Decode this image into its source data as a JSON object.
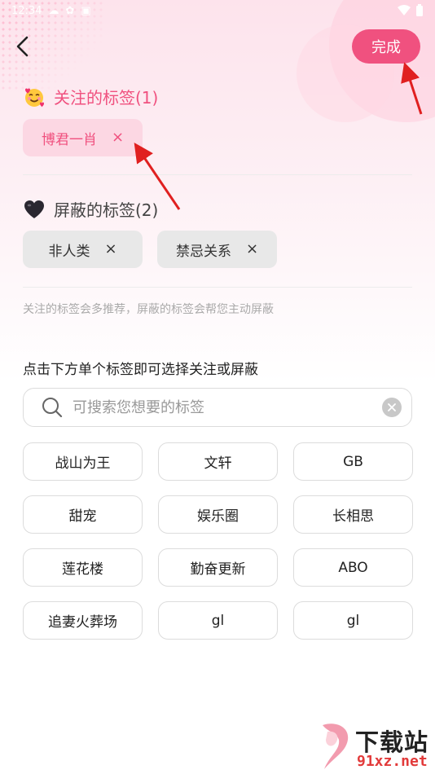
{
  "status_bar": {
    "time": "12:34",
    "left_icons": [
      "cloud-icon",
      "settings-icon",
      "notification-icon"
    ],
    "right_icons": [
      "wifi-icon",
      "battery-icon"
    ]
  },
  "header": {
    "done_label": "完成"
  },
  "followed": {
    "title": "关注的标签(1)",
    "emoji": "smiling-face-with-hearts-icon",
    "tags": [
      {
        "label": "博君一肖",
        "remove": "×"
      }
    ]
  },
  "blocked": {
    "title": "屏蔽的标签(2)",
    "emoji": "black-heart-icon",
    "tags": [
      {
        "label": "非人类",
        "remove": "×"
      },
      {
        "label": "禁忌关系",
        "remove": "×"
      }
    ]
  },
  "hint": "关注的标签会多推荐，屏蔽的标签会帮您主动屏蔽",
  "instruction": "点击下方单个标签即可选择关注或屏蔽",
  "search": {
    "placeholder": "可搜索您想要的标签",
    "value": ""
  },
  "tags": [
    "战山为王",
    "文轩",
    "GB",
    "甜宠",
    "娱乐圈",
    "长相思",
    "莲花楼",
    "勤奋更新",
    "ABO",
    "追妻火葬场",
    "gl",
    "gl"
  ],
  "watermark": {
    "line1": "下载站",
    "line2": "91xz.net"
  },
  "colors": {
    "accent": "#f0517f",
    "follow_chip_bg": "#fcd7e3",
    "block_chip_bg": "#e8e8e8",
    "annotation_arrow": "#e02020"
  }
}
